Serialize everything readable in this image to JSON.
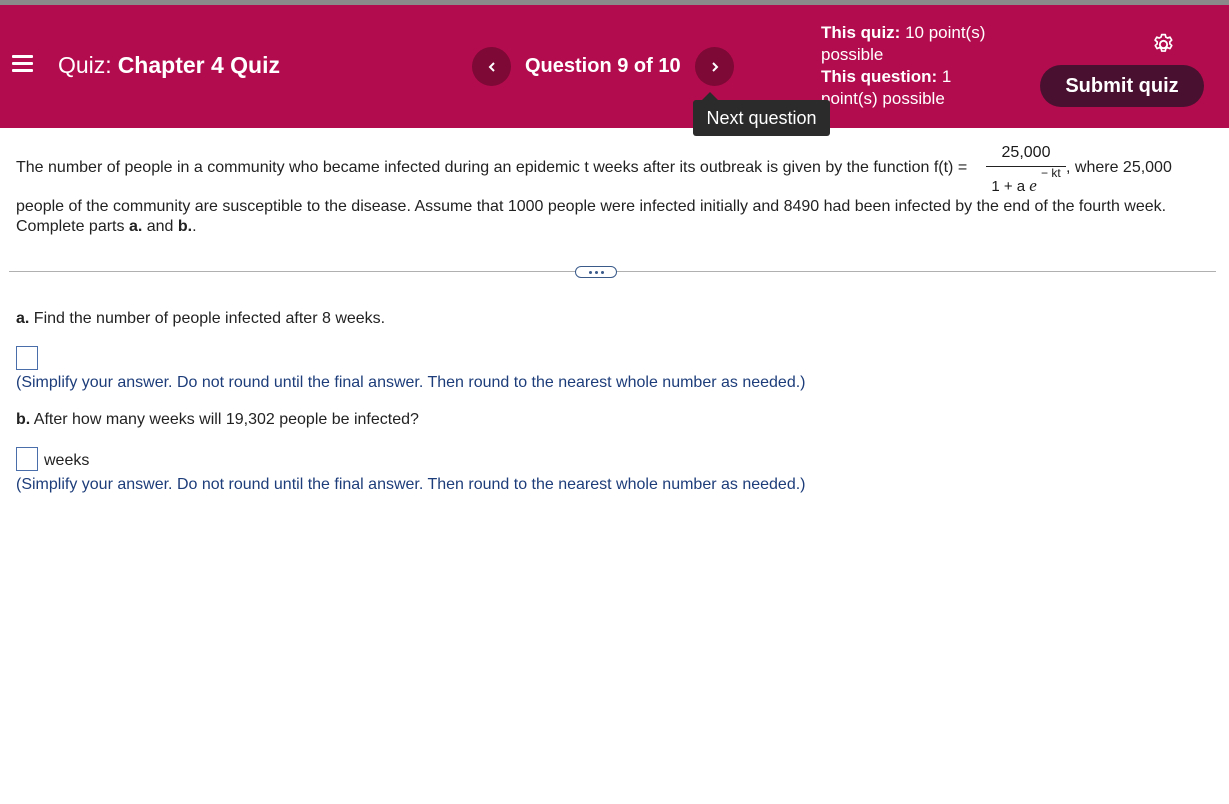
{
  "header": {
    "quiz_prefix": "Quiz:",
    "quiz_name": "Chapter 4 Quiz",
    "question_position": "Question 9 of 10",
    "quiz_points_label": "This quiz:",
    "quiz_points_value": "10 point(s)",
    "quiz_points_value2": "possible",
    "question_points_label": "This question:",
    "question_points_value": "1",
    "question_points_value2": "point(s) possible",
    "submit_label": "Submit quiz",
    "next_tooltip": "Next question",
    "icons": [
      "menu-icon",
      "chevron-left-icon",
      "chevron-right-icon",
      "gear-icon"
    ]
  },
  "problem": {
    "line1_start": "The number of people in a community who became infected during an epidemic t weeks after its outbreak is given by the function f(t) =",
    "numerator": "25,000",
    "denominator_base": "1 + a",
    "denominator_e": "e",
    "denominator_exp": "− kt",
    "line1_end": ", where 25,000",
    "line2": "people of the community are susceptible to the disease. Assume that 1000 people were infected initially and 8490 had been infected by the end of the fourth week.",
    "line3_start": "Complete parts",
    "line3_a": "a.",
    "line3_and": "and",
    "line3_b": "b.",
    "line3_end": "."
  },
  "part_a": {
    "label": "a.",
    "question": "Find the number of people infected after 8 weeks.",
    "answer_value": "",
    "hint": "(Simplify your answer. Do not round until the final answer. Then round to the nearest whole number as needed.)"
  },
  "part_b": {
    "label": "b.",
    "question": "After how many weeks will 19,302 people be infected?",
    "answer_value": "",
    "unit": "weeks",
    "hint": "(Simplify your answer. Do not round until the final answer. Then round to the nearest whole number as needed.)"
  },
  "colors": {
    "header_bg": "#b30c4e",
    "nav_button_bg": "#7e0836",
    "submit_bg": "#4a1030",
    "hint_text": "#1d3d7a"
  }
}
